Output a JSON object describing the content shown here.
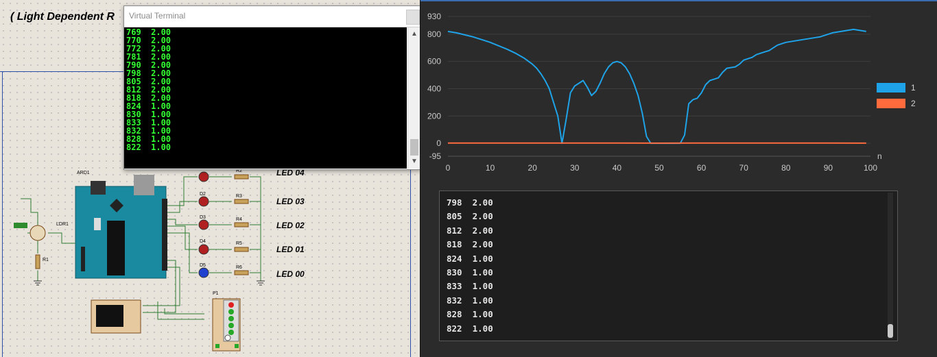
{
  "schematic": {
    "title": "( Light Dependent R",
    "led_labels": [
      "LED 04",
      "LED 03",
      "LED 02",
      "LED 01",
      "LED 00"
    ],
    "component_labels": [
      "ARD1",
      "LDR1",
      "R1",
      "D2",
      "D3",
      "D4",
      "D5",
      "R2",
      "R3",
      "R4",
      "R5",
      "R6",
      "P1"
    ],
    "led_colors": [
      "#b02020",
      "#b02020",
      "#b02020",
      "#b02020",
      "#2040d0"
    ]
  },
  "virtual_terminal": {
    "title": "Virtual Terminal",
    "lines": [
      "769  2.00",
      "770  2.00",
      "772  2.00",
      "781  2.00",
      "790  2.00",
      "798  2.00",
      "805  2.00",
      "812  2.00",
      "818  2.00",
      "824  1.00",
      "830  1.00",
      "833  1.00",
      "832  1.00",
      "828  1.00",
      "822  1.00"
    ]
  },
  "chart_data": {
    "type": "line",
    "xlabel": "n",
    "xlim": [
      0,
      100
    ],
    "ylim": [
      -95,
      930
    ],
    "xticks": [
      0,
      10,
      20,
      30,
      40,
      50,
      60,
      70,
      80,
      90,
      100
    ],
    "yticks": [
      930,
      800,
      600,
      400,
      200,
      0,
      -95
    ],
    "legend_position": "right",
    "series": [
      {
        "name": "1",
        "color": "#1fa3e8",
        "x": [
          0,
          2,
          4,
          6,
          8,
          10,
          12,
          14,
          16,
          18,
          20,
          21,
          22,
          23,
          24,
          25,
          26,
          27,
          28,
          29,
          30,
          31,
          32,
          33,
          34,
          35,
          36,
          37,
          38,
          39,
          40,
          41,
          42,
          43,
          44,
          45,
          46,
          47,
          48,
          50,
          52,
          54,
          55,
          56,
          57,
          58,
          59,
          60,
          61,
          62,
          63,
          64,
          65,
          66,
          67,
          68,
          69,
          70,
          71,
          72,
          73,
          74,
          75,
          76,
          77,
          78,
          79,
          80,
          81,
          82,
          83,
          84,
          85,
          86,
          87,
          88,
          89,
          90,
          91,
          92,
          93,
          94,
          95,
          96,
          97,
          98,
          99
        ],
        "values": [
          820,
          810,
          795,
          780,
          760,
          740,
          715,
          690,
          660,
          625,
          580,
          550,
          510,
          460,
          400,
          300,
          200,
          0,
          180,
          370,
          420,
          440,
          460,
          410,
          350,
          380,
          440,
          510,
          560,
          590,
          600,
          590,
          560,
          510,
          440,
          350,
          220,
          50,
          0,
          0,
          0,
          0,
          0,
          60,
          290,
          320,
          330,
          370,
          430,
          460,
          470,
          480,
          520,
          550,
          555,
          560,
          580,
          610,
          620,
          630,
          650,
          660,
          670,
          680,
          700,
          720,
          730,
          740,
          745,
          750,
          755,
          760,
          765,
          770,
          775,
          780,
          790,
          800,
          810,
          815,
          820,
          825,
          830,
          835,
          830,
          825,
          820
        ]
      },
      {
        "name": "2",
        "color": "#ff6b3d",
        "x": [
          0,
          10,
          20,
          30,
          40,
          50,
          60,
          70,
          80,
          90,
          99
        ],
        "values": [
          2,
          2,
          2,
          2,
          2,
          1,
          2,
          2,
          2,
          2,
          1
        ]
      }
    ]
  },
  "console": {
    "lines": [
      "798  2.00",
      "805  2.00",
      "812  2.00",
      "818  2.00",
      "824  1.00",
      "830  1.00",
      "833  1.00",
      "832  1.00",
      "828  1.00",
      "822  1.00"
    ]
  }
}
